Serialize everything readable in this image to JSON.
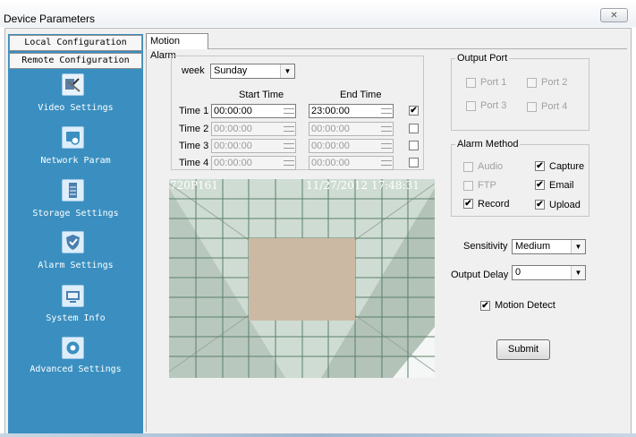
{
  "window": {
    "title": "Device Parameters",
    "close_glyph": "✕"
  },
  "sidebar": {
    "local_tab": "Local Configuration",
    "remote_tab": "Remote Configuration",
    "items": [
      {
        "label": "Video Settings",
        "icon": "video-settings-icon"
      },
      {
        "label": "Network Param",
        "icon": "network-icon"
      },
      {
        "label": "Storage Settings",
        "icon": "storage-icon"
      },
      {
        "label": "Alarm Settings",
        "icon": "alarm-shield-icon"
      },
      {
        "label": "System Info",
        "icon": "system-info-icon"
      },
      {
        "label": "Advanced Settings",
        "icon": "advanced-gear-icon"
      }
    ]
  },
  "tab": {
    "label": "Motion Alarm"
  },
  "schedule": {
    "week_label": "week",
    "week_value": "Sunday",
    "start_header": "Start Time",
    "end_header": "End Time",
    "rows": [
      {
        "label": "Time 1",
        "start": "00:00:00",
        "end": "23:00:00",
        "checked": true,
        "enabled": true
      },
      {
        "label": "Time 2",
        "start": "00:00:00",
        "end": "00:00:00",
        "checked": false,
        "enabled": false
      },
      {
        "label": "Time 3",
        "start": "00:00:00",
        "end": "00:00:00",
        "checked": false,
        "enabled": false
      },
      {
        "label": "Time 4",
        "start": "00:00:00",
        "end": "00:00:00",
        "checked": false,
        "enabled": false
      }
    ]
  },
  "video": {
    "camera_id": "720P161",
    "timestamp": "11/27/2012 17:48:31"
  },
  "output_port": {
    "title": "Output Port",
    "ports": [
      {
        "label": "Port 1",
        "checked": false
      },
      {
        "label": "Port 2",
        "checked": false
      },
      {
        "label": "Port 3",
        "checked": false
      },
      {
        "label": "Port 4",
        "checked": false
      }
    ]
  },
  "alarm_method": {
    "title": "Alarm Method",
    "items": [
      {
        "label": "Audio",
        "checked": false,
        "enabled": false
      },
      {
        "label": "Capture",
        "checked": true,
        "enabled": true
      },
      {
        "label": "FTP",
        "checked": false,
        "enabled": false
      },
      {
        "label": "Email",
        "checked": true,
        "enabled": true
      },
      {
        "label": "Record",
        "checked": true,
        "enabled": true
      },
      {
        "label": "Upload",
        "checked": true,
        "enabled": true
      }
    ]
  },
  "sensitivity": {
    "label": "Sensitivity",
    "value": "Medium"
  },
  "output_delay": {
    "label": "Output Delay",
    "value": "0"
  },
  "motion_detect": {
    "label": "Motion Detect",
    "checked": true
  },
  "submit_label": "Submit",
  "check_glyph": "✔",
  "dropdown_glyph": "▼",
  "colors": {
    "sidebar": "#3a8fc0",
    "motion_mask": "#ccb9a3",
    "video_bg": "#c9d6cc"
  }
}
